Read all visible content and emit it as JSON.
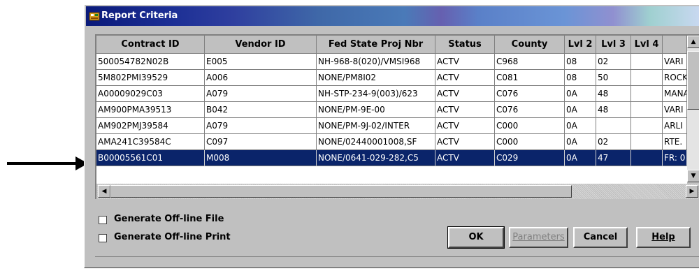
{
  "window": {
    "title": "Report Criteria"
  },
  "grid": {
    "columns": [
      "Contract ID",
      "Vendor ID",
      "Fed State Proj Nbr",
      "Status",
      "County",
      "Lvl 2",
      "Lvl 3",
      "Lvl 4",
      ""
    ],
    "rows": [
      [
        "500054782N02B",
        "E005",
        "NH-968-8(020)/VMSI968",
        "ACTV",
        "C968",
        "08",
        "02",
        "",
        "VARI"
      ],
      [
        "5M802PMI39529",
        "A006",
        "NONE/PM8I02",
        "ACTV",
        "C081",
        "08",
        "50",
        "",
        "ROCK"
      ],
      [
        "A00009029C03",
        "A079",
        "NH-STP-234-9(003)/623",
        "ACTV",
        "C076",
        "0A",
        "48",
        "",
        "MANA"
      ],
      [
        "AM900PMA39513",
        "B042",
        "NONE/PM-9E-00",
        "ACTV",
        "C076",
        "0A",
        "48",
        "",
        "VARI"
      ],
      [
        "AM902PMJ39584",
        "A079",
        "NONE/PM-9J-02/INTER",
        "ACTV",
        "C000",
        "0A",
        "",
        "",
        "ARLI"
      ],
      [
        "AMA241C39584C",
        "C097",
        "NONE/02440001008,SF",
        "ACTV",
        "C000",
        "0A",
        "02",
        "",
        "RTE."
      ],
      [
        "B00005561C01",
        "M008",
        "NONE/0641-029-282,C5",
        "ACTV",
        "C029",
        "0A",
        "47",
        "",
        "FR: 0"
      ]
    ],
    "selected_row": 6
  },
  "options": {
    "offline_file_label": "Generate Off-line File",
    "offline_print_label": "Generate Off-line Print"
  },
  "buttons": {
    "ok": "OK",
    "parameters": "Parameters",
    "cancel": "Cancel",
    "help": "Help"
  },
  "colors": {
    "selection": "#0a246a",
    "window_bg": "#c0c0c0"
  }
}
